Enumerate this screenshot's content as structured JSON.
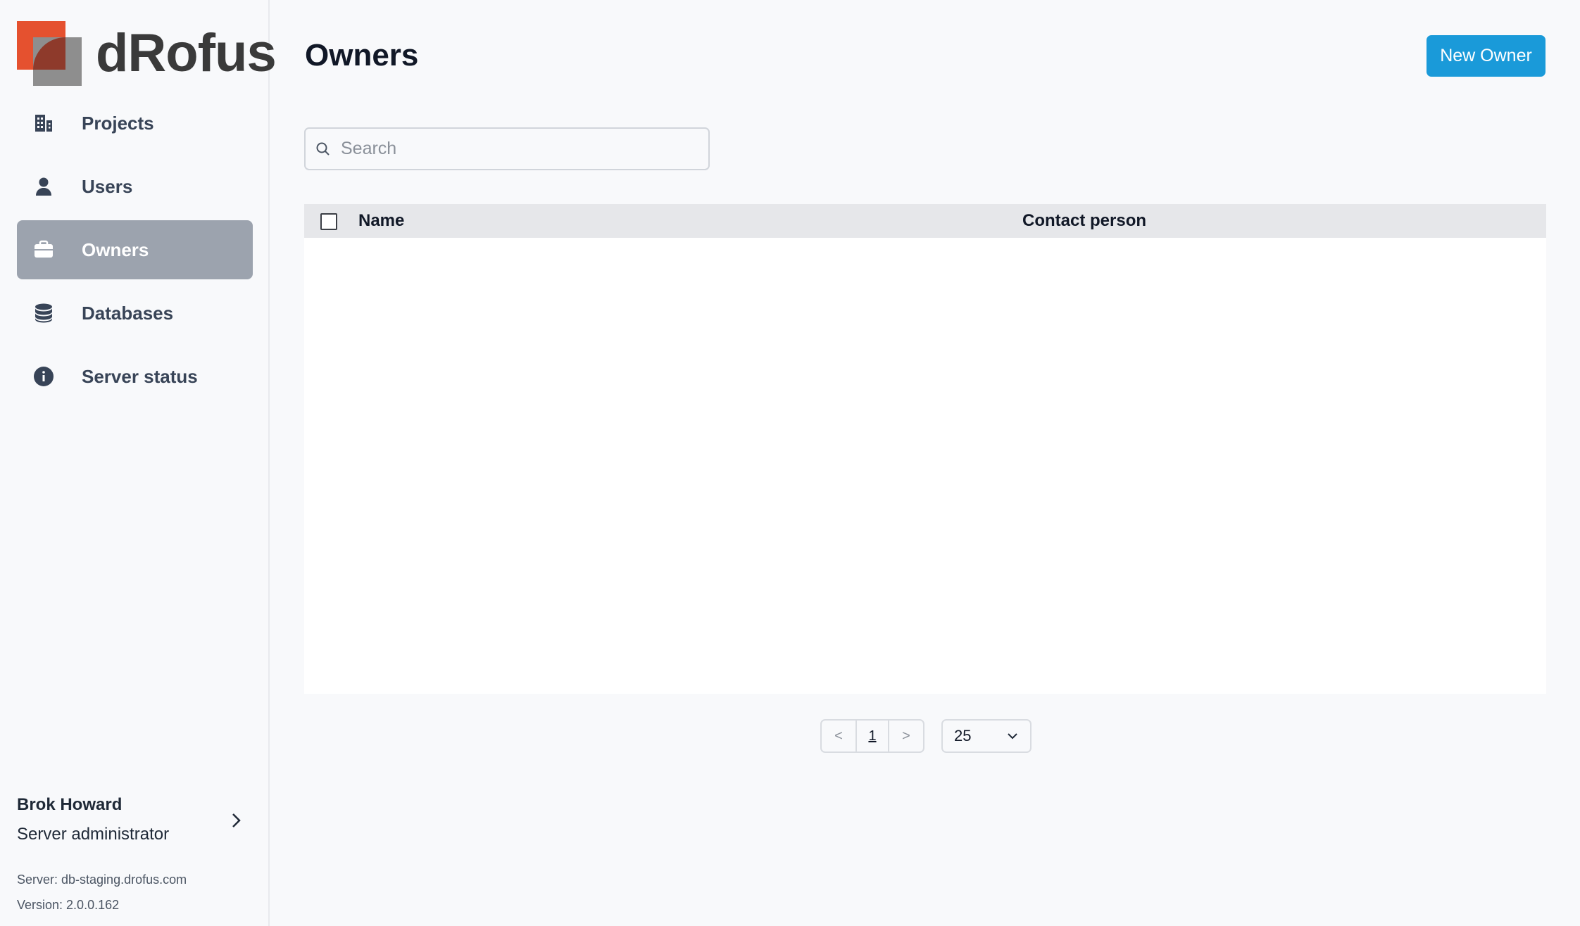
{
  "app": {
    "brand": "dRofus"
  },
  "sidebar": {
    "items": [
      {
        "label": "Projects",
        "icon": "building-icon",
        "active": false
      },
      {
        "label": "Users",
        "icon": "user-icon",
        "active": false
      },
      {
        "label": "Owners",
        "icon": "briefcase-icon",
        "active": true
      },
      {
        "label": "Databases",
        "icon": "database-icon",
        "active": false
      },
      {
        "label": "Server status",
        "icon": "info-icon",
        "active": false
      }
    ],
    "user": {
      "name": "Brok Howard",
      "role": "Server administrator"
    },
    "server": "Server: db-staging.drofus.com",
    "version": "Version: 2.0.0.162"
  },
  "main": {
    "title": "Owners",
    "new_button": "New Owner",
    "search": {
      "placeholder": "Search",
      "value": ""
    },
    "table": {
      "columns": [
        "Name",
        "Contact person"
      ],
      "rows": []
    },
    "pagination": {
      "prev": "<",
      "current_page": "1",
      "next": ">",
      "per_page": "25"
    }
  },
  "colors": {
    "accent": "#1a9ad9",
    "active_nav": "#9ca3ae",
    "brand_red": "#e5512f"
  }
}
